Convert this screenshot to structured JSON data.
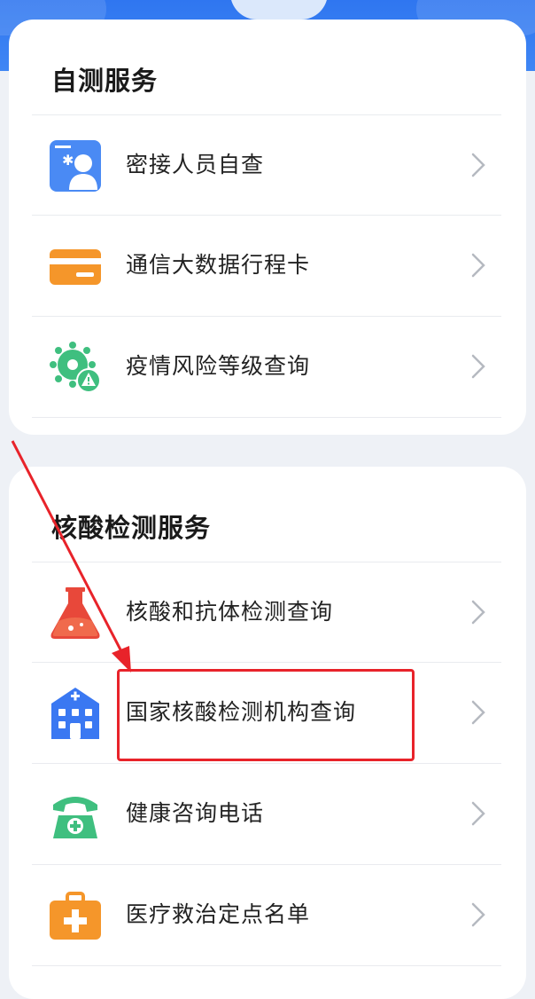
{
  "self_test": {
    "title": "自测服务",
    "items": [
      {
        "label": "密接人员自查",
        "icon": "contact-person-icon"
      },
      {
        "label": "通信大数据行程卡",
        "icon": "card-icon"
      },
      {
        "label": "疫情风险等级查询",
        "icon": "virus-warning-icon"
      }
    ]
  },
  "nucleic": {
    "title": "核酸检测服务",
    "items": [
      {
        "label": "核酸和抗体检测查询",
        "icon": "flask-icon"
      },
      {
        "label": "国家核酸检测机构查询",
        "icon": "hospital-icon"
      },
      {
        "label": "健康咨询电话",
        "icon": "telephone-icon"
      },
      {
        "label": "医疗救治定点名单",
        "icon": "medical-kit-icon"
      }
    ]
  },
  "annotation": {
    "highlight_color": "#e8232a",
    "highlighted_item": "国家核酸检测机构查询"
  },
  "colors": {
    "brand_blue": "#2f76f0",
    "orange": "#f5962a",
    "green": "#3fbf7f",
    "red": "#e8483a",
    "icon_blue": "#3a78f2"
  }
}
